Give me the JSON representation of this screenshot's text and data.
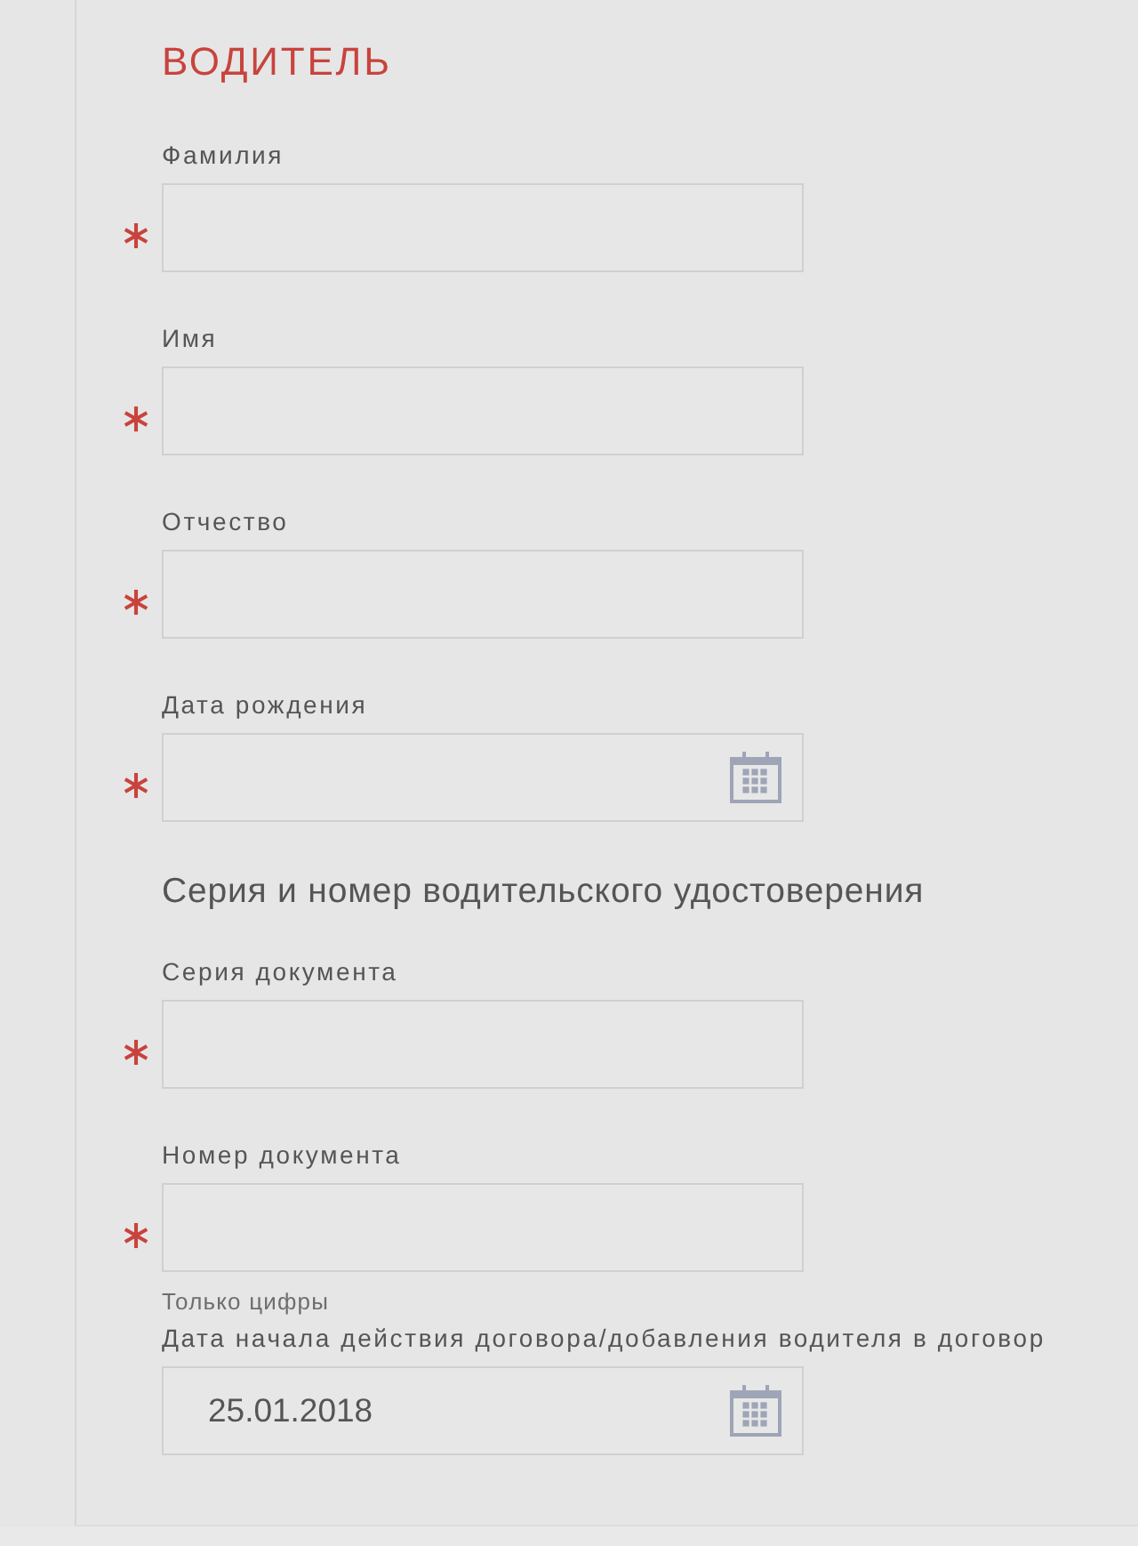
{
  "title": "ВОДИТЕЛЬ",
  "items": [
    {
      "kind": "text",
      "label": "Фамилия",
      "required": true
    },
    {
      "kind": "text",
      "label": "Имя",
      "required": true
    },
    {
      "kind": "text",
      "label": "Отчество",
      "required": true
    },
    {
      "kind": "date",
      "label": "Дата рождения",
      "required": true
    },
    {
      "kind": "heading",
      "label": "Серия и номер водительского удостоверения"
    },
    {
      "kind": "text",
      "label": "Серия документа",
      "required": true
    },
    {
      "kind": "text",
      "label": "Номер документа",
      "required": true,
      "hint": "Только цифры"
    },
    {
      "kind": "date",
      "label": "Дата начала действия договора/добавления водителя в договор",
      "required": false,
      "value": "25.01.2018"
    }
  ]
}
